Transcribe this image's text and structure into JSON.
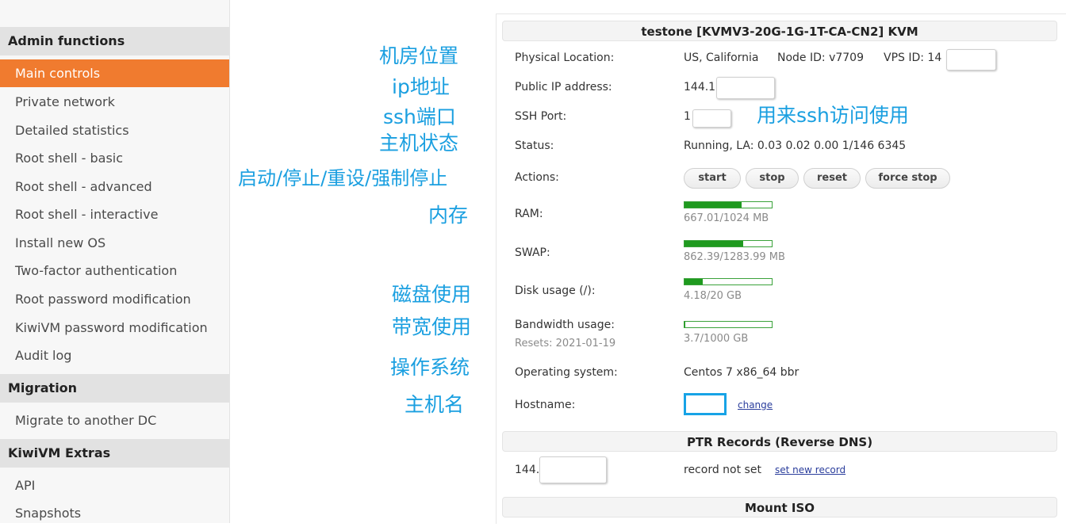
{
  "sidebar": {
    "admin_header": "Admin functions",
    "admin_items": [
      {
        "label": "Main controls",
        "active": true
      },
      {
        "label": "Private network"
      },
      {
        "label": "Detailed statistics"
      },
      {
        "label": "Root shell - basic"
      },
      {
        "label": "Root shell - advanced"
      },
      {
        "label": "Root shell - interactive"
      },
      {
        "label": "Install new OS"
      },
      {
        "label": "Two-factor authentication"
      },
      {
        "label": "Root password modification"
      },
      {
        "label": "KiwiVM password modification"
      },
      {
        "label": "Audit log"
      }
    ],
    "migration_header": "Migration",
    "migration_items": [
      {
        "label": "Migrate to another DC"
      }
    ],
    "extras_header": "KiwiVM Extras",
    "extras_items": [
      {
        "label": "API"
      },
      {
        "label": "Snapshots"
      }
    ]
  },
  "annotations": {
    "location": "机房位置",
    "ip": "ip地址",
    "ssh_port": "ssh端口",
    "status": "主机状态",
    "actions": "启动/停止/重设/强制停止",
    "ram": "内存",
    "disk": "磁盘使用",
    "bandwidth": "带宽使用",
    "os": "操作系统",
    "hostname": "主机名",
    "ssh_note": "用来ssh访问使用"
  },
  "main": {
    "server_header": "testone   [KVMV3-20G-1G-1T-CA-CN2]   KVM",
    "labels": {
      "location": "Physical Location:",
      "ip": "Public IP address:",
      "ssh": "SSH Port:",
      "status": "Status:",
      "actions": "Actions:",
      "ram": "RAM:",
      "swap": "SWAP:",
      "disk": "Disk usage (/):",
      "bandwidth": "Bandwidth usage:",
      "bandwidth_reset": "Resets: 2021-01-19",
      "os": "Operating system:",
      "hostname": "Hostname:"
    },
    "values": {
      "location": "US, California",
      "node_id": "Node ID: v7709",
      "vps_id": "VPS ID: 14",
      "ip": "144.1",
      "ssh": "1",
      "status": "Running, LA: 0.03 0.02 0.00 1/146 6345",
      "os": "Centos 7 x86_64 bbr"
    },
    "actions": {
      "start": "start",
      "stop": "stop",
      "reset": "reset",
      "force_stop": "force stop"
    },
    "usage": {
      "ram": {
        "text": "667.01/1024 MB",
        "fraction": 0.651
      },
      "swap": {
        "text": "862.39/1283.99 MB",
        "fraction": 0.672
      },
      "disk": {
        "text": "4.18/20 GB",
        "fraction": 0.209
      },
      "bandwidth": {
        "text": "3.7/1000 GB",
        "fraction": 0.0037
      }
    },
    "hostname_change": "change",
    "ptr_header": "PTR Records (Reverse DNS)",
    "ptr_ip": "144.",
    "ptr_status": "record not set",
    "ptr_link": "set new record",
    "iso_header": "Mount ISO"
  }
}
